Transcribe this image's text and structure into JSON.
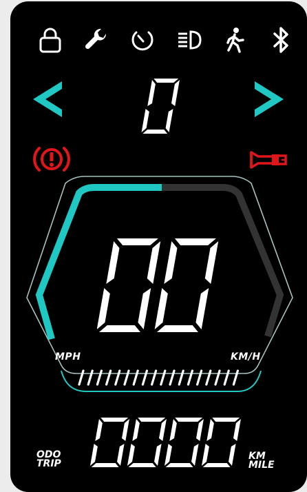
{
  "colors": {
    "accent": "#20c8c4",
    "warning": "#e0161b",
    "segment": "#ffffff",
    "background": "#000000"
  },
  "status_icons": [
    "lock-icon",
    "wrench-icon",
    "speedometer-icon",
    "headlight-icon",
    "walk-assist-icon",
    "bluetooth-icon"
  ],
  "left_indicator_icon": "turn-left-arrow-icon",
  "right_indicator_icon": "turn-right-arrow-icon",
  "warnings": {
    "left": "brake-warning-icon",
    "right": "horn-icon"
  },
  "gear_level": "0",
  "speed": {
    "value": "00",
    "unit_left": "MPH",
    "unit_right": "KM/H"
  },
  "speed_arc_level": 0.5,
  "odometer": {
    "value": "0000",
    "mode_top": "ODO",
    "mode_bottom": "TRIP",
    "unit_top": "KM",
    "unit_bottom": "MILE"
  }
}
